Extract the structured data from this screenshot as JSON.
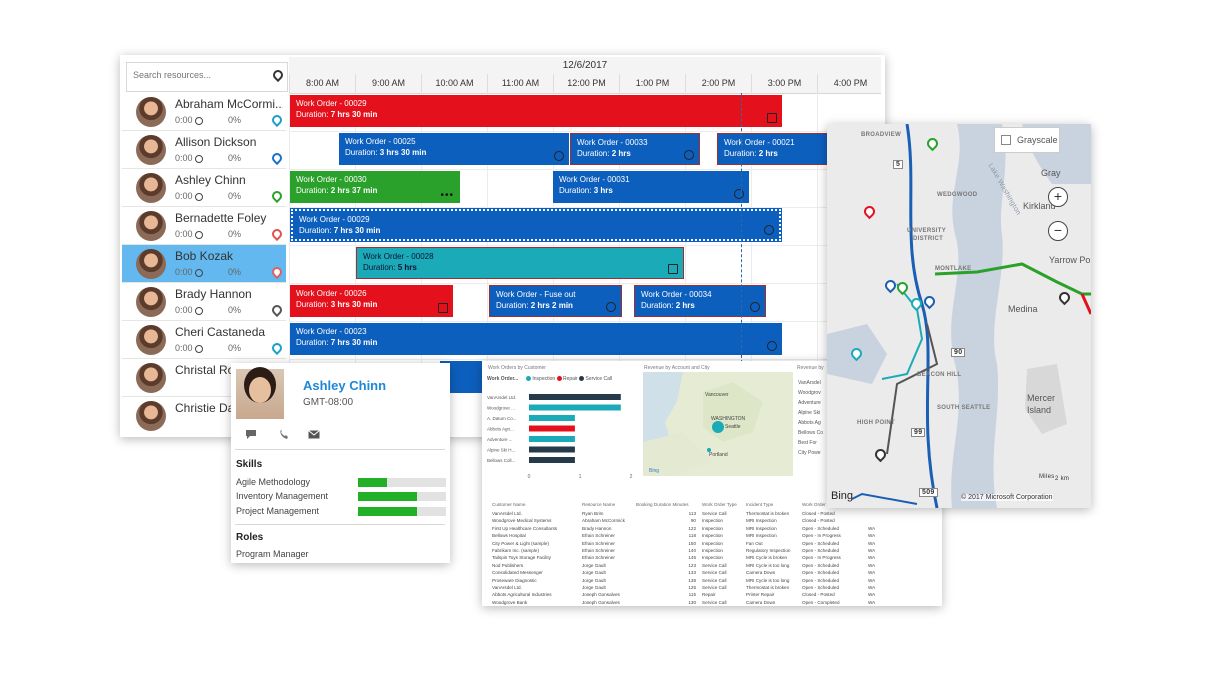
{
  "scheduler": {
    "search_placeholder": "Search resources...",
    "date": "12/6/2017",
    "hours": [
      "8:00 AM",
      "9:00 AM",
      "10:00 AM",
      "11:00 AM",
      "12:00 PM",
      "1:00 PM",
      "2:00 PM",
      "3:00 PM",
      "4:00 PM"
    ],
    "resources": [
      {
        "name": "Abraham McCormi...",
        "hours": "0:00",
        "pct": "0%",
        "pin_color": "#1aa0c8",
        "selected": false
      },
      {
        "name": "Allison Dickson",
        "hours": "0:00",
        "pct": "0%",
        "pin_color": "#1a6fcf",
        "selected": false
      },
      {
        "name": "Ashley Chinn",
        "hours": "0:00",
        "pct": "0%",
        "pin_color": "#2aa12a",
        "selected": false
      },
      {
        "name": "Bernadette Foley",
        "hours": "0:00",
        "pct": "0%",
        "pin_color": "#e05050",
        "selected": false
      },
      {
        "name": "Bob Kozak",
        "hours": "0:00",
        "pct": "0%",
        "pin_color": "#e06060",
        "selected": true
      },
      {
        "name": "Brady Hannon",
        "hours": "0:00",
        "pct": "0%",
        "pin_color": "#555555",
        "selected": false
      },
      {
        "name": "Cheri Castaneda",
        "hours": "0:00",
        "pct": "0%",
        "pin_color": "#1aa0c8",
        "selected": false
      },
      {
        "name": "Christal Rob",
        "hours": "",
        "pct": "",
        "pin_color": "",
        "selected": false
      },
      {
        "name": "Christie Dav",
        "hours": "",
        "pct": "",
        "pin_color": "",
        "selected": false
      }
    ],
    "work_orders": {
      "r0_a": {
        "title": "Work Order - 00029",
        "duration_label": "Duration:",
        "duration": "7 hrs 30 min"
      },
      "r1_a": {
        "title": "Work Order - 00025",
        "duration_label": "Duration:",
        "duration": "3 hrs 30 min"
      },
      "r1_b": {
        "title": "Work Order - 00033",
        "duration_label": "Duration:",
        "duration": "2 hrs"
      },
      "r1_c": {
        "title": "Work Order - 00021",
        "duration_label": "Duration:",
        "duration": "2 hrs"
      },
      "r2_a": {
        "title": "Work Order - 00030",
        "duration_label": "Duration:",
        "duration": "2 hrs 37 min"
      },
      "r2_b": {
        "title": "Work Order - 00031",
        "duration_label": "Duration:",
        "duration": "3 hrs"
      },
      "r3_a": {
        "title": "Work Order - 00029",
        "duration_label": "Duration:",
        "duration": "7 hrs 30 min"
      },
      "r4_a": {
        "title": "Work Order - 00028",
        "duration_label": "Duration:",
        "duration": "5 hrs"
      },
      "r5_a": {
        "title": "Work Order - 00026",
        "duration_label": "Duration:",
        "duration": "3 hrs 30 min"
      },
      "r5_b": {
        "title": "Work Order - Fuse out",
        "duration_label": "Duration:",
        "duration": "2 hrs 2 min"
      },
      "r5_c": {
        "title": "Work Order - 00034",
        "duration_label": "Duration:",
        "duration": "2 hrs"
      },
      "r6_a": {
        "title": "Work Order - 00023",
        "duration_label": "Duration:",
        "duration": "7 hrs 30 min"
      }
    },
    "colors": {
      "red": "#e4111d",
      "blue": "#0d5fbd",
      "green": "#2aa12a",
      "teal": "#1aaab8",
      "selected_row": "#62b8ef"
    }
  },
  "contact_card": {
    "name": "Ashley Chinn",
    "timezone": "GMT-08:00",
    "actions": [
      "chat-icon",
      "phone-icon",
      "email-icon"
    ],
    "skills_heading": "Skills",
    "skills": [
      {
        "name": "Agile Methodology",
        "level": 0.33
      },
      {
        "name": "Inventory Management",
        "level": 0.67
      },
      {
        "name": "Project Management",
        "level": 0.67
      }
    ],
    "roles_heading": "Roles",
    "roles": [
      "Program Manager"
    ]
  },
  "analytics": {
    "panel1_title": "Work Orders by Customer",
    "panel2_title": "Revenue by Account and City",
    "panel3_title": "Revenue by",
    "legend_label": "Work Order...",
    "legend": [
      {
        "name": "Inspection",
        "color": "#1aaab8"
      },
      {
        "name": "Repair",
        "color": "#e4111d"
      },
      {
        "name": "Service Call",
        "color": "#253a4a"
      }
    ],
    "chart_data": {
      "type": "bar",
      "categories": [
        "VanArsdel Ltd.",
        "Woodgrove ...",
        "A. Datum Co...",
        "Abbots Agri...",
        "Adventure ...",
        "Alpine Ski H...",
        "Bellows Coll..."
      ],
      "values": [
        1.8,
        1.8,
        0.9,
        0.9,
        0.9,
        0.9,
        0.9
      ],
      "x_ticks": [
        "0",
        "1",
        "2"
      ],
      "xlim": [
        0,
        2
      ]
    },
    "map_labels": {
      "region": "WASHINGTON",
      "city1": "Seattle",
      "city2": "Portland",
      "city3": "Vancouver",
      "logo": "Bing"
    },
    "side_list": [
      "VanArsdel",
      "Woodgrov",
      "Adventure",
      "Alpine Ski",
      "Abbots Ag",
      "Bellows Co",
      "Best For",
      "City Powe"
    ],
    "table_headers": [
      "Customer Name",
      "Resource Name",
      "Booking Duration Minutes",
      "Work Order Type",
      "Incident Type",
      "Work Order Status"
    ],
    "table_rows": [
      [
        "VanArsdel Ltd.",
        "Ryan Brim",
        "113",
        "Service Call",
        "Thermostat is broken",
        "Closed - Posted",
        ""
      ],
      [
        "Woodgrove Medical Systems",
        "Abraham McCormick",
        "90",
        "Inspection",
        "MRI Inspection",
        "Closed - Posted",
        ""
      ],
      [
        "First Up Healthcare Consultants",
        "Brady Hannon",
        "122",
        "Inspection",
        "MRI Inspection",
        "Open - Scheduled",
        "WA"
      ],
      [
        "Bellows Hospital",
        "Efrain Schreiner",
        "118",
        "Inspection",
        "MRI Inspection",
        "Open - In Progress",
        "WA"
      ],
      [
        "City Power & Light (sample)",
        "Efrain Schreiner",
        "150",
        "Inspection",
        "Fan Out",
        "Open - Scheduled",
        "WA"
      ],
      [
        "Fabrikam Inc. (sample)",
        "Efrain Schreiner",
        "140",
        "Inspection",
        "Regulatory Inspection",
        "Open - Scheduled",
        "WA"
      ],
      [
        "Tailspin Toys Storage Facility",
        "Efrain Schreiner",
        "145",
        "Inspection",
        "MRI Cycle is broken",
        "Open - In Progress",
        "WA"
      ],
      [
        "Nod Publishers",
        "Jorge Gault",
        "123",
        "Service Call",
        "MRI Cycle is too long",
        "Open - Scheduled",
        "WA"
      ],
      [
        "Consolidated Messenger",
        "Jorge Gault",
        "133",
        "Service Call",
        "Camera Down",
        "Open - Scheduled",
        "WA"
      ],
      [
        "Proseware Diagnostic",
        "Jorge Gault",
        "138",
        "Service Call",
        "MRI Cycle is too long",
        "Open - Scheduled",
        "WA"
      ],
      [
        "VanArsdel Ltd.",
        "Jorge Gault",
        "125",
        "Service Call",
        "Thermostat is broken",
        "Open - Scheduled",
        "WA"
      ],
      [
        "Abbots Agricultural Industries",
        "Joseph Gonsalves",
        "115",
        "Repair",
        "Printer Repair",
        "Closed - Posted",
        "WA"
      ],
      [
        "Woodgrove Bank",
        "Joseph Gonsalves",
        "130",
        "Service Call",
        "Camera Down",
        "Open - Completed",
        "WA"
      ]
    ]
  },
  "map": {
    "grayscale_label": "Grayscale",
    "zoom_in": "+",
    "zoom_out": "−",
    "labels": {
      "broadview": "BROADVIEW",
      "wedgwood": "WEDGWOOD",
      "university": "UNIVERSITY",
      "district": "DISTRICT",
      "montlake": "MONTLAKE",
      "beacon_hill": "BEACON HILL",
      "south_seattle": "SOUTH SEATTLE",
      "high_point": "HIGH POINT",
      "lake_washington": "Lake Washington",
      "kirkland": "Kirkland",
      "yarrow_point": "Yarrow Point",
      "medina": "Medina",
      "mercer_island": "Mercer Island",
      "gray": "Gray",
      "miles": "Miles",
      "km": "2 km"
    },
    "highways": [
      "5",
      "90",
      "99",
      "509"
    ],
    "logo": "Bing",
    "copyright": "© 2017 Microsoft Corporation",
    "route_colors": [
      "#0d5fbd",
      "#2aa12a",
      "#e4111d",
      "#1aaab8",
      "#555555"
    ]
  }
}
